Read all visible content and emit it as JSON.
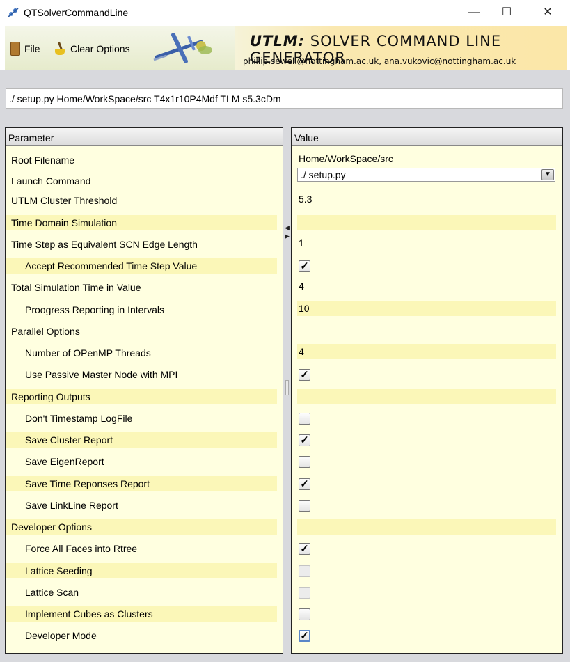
{
  "window": {
    "title": "QTSolverCommandLine",
    "minimize_glyph": "—",
    "maximize_glyph": "☐",
    "close_glyph": "✕"
  },
  "toolbar": {
    "file_label": "File",
    "clear_label": "Clear Options"
  },
  "banner": {
    "title_prefix": "UTLM:",
    "title_rest": " SOLVER COMMAND LINE GENERATOR",
    "emails": "phillip.sewell@nottingham.ac.uk, ana.vukovic@nottingham.ac.uk"
  },
  "command_line": "./ setup.py Home/WorkSpace/src T4x1r10P4Mdf TLM s5.3cDm",
  "table": {
    "param_header": "Parameter",
    "value_header": "Value",
    "rows": [
      {
        "param": "Root Filename",
        "indent": false,
        "hl": false,
        "type": "text",
        "value": "Home/WorkSpace/src"
      },
      {
        "param": "Launch Command",
        "indent": false,
        "hl": false,
        "type": "select",
        "value": "./ setup.py"
      },
      {
        "param": "UTLM Cluster Threshold",
        "indent": false,
        "hl": false,
        "type": "text",
        "value": "5.3"
      },
      {
        "param": "Time Domain Simulation",
        "indent": false,
        "hl": true,
        "type": "none",
        "value": ""
      },
      {
        "param": "Time Step as Equivalent SCN Edge Length",
        "indent": false,
        "hl": false,
        "type": "text",
        "value": "1"
      },
      {
        "param": "Accept Recommended Time Step Value",
        "indent": true,
        "hl": true,
        "type": "checkbox",
        "checked": true,
        "disabled": false,
        "focused": false
      },
      {
        "param": "Total Simulation Time in Value",
        "indent": false,
        "hl": false,
        "type": "text",
        "value": "4"
      },
      {
        "param": "Proogress Reporting in Intervals",
        "indent": true,
        "hl": false,
        "type": "text",
        "value": "10",
        "value_hl": true
      },
      {
        "param": "Parallel Options",
        "indent": false,
        "hl": false,
        "type": "none",
        "value": ""
      },
      {
        "param": "Number of OPenMP Threads",
        "indent": true,
        "hl": false,
        "type": "text",
        "value": "4",
        "value_hl": true
      },
      {
        "param": "Use Passive Master Node with MPI",
        "indent": true,
        "hl": false,
        "type": "checkbox",
        "checked": true,
        "disabled": false,
        "focused": false
      },
      {
        "param": "Reporting Outputs",
        "indent": false,
        "hl": true,
        "type": "none",
        "value": ""
      },
      {
        "param": "Don't Timestamp LogFile",
        "indent": true,
        "hl": false,
        "type": "checkbox",
        "checked": false,
        "disabled": false,
        "focused": false
      },
      {
        "param": "Save Cluster Report",
        "indent": true,
        "hl": true,
        "type": "checkbox",
        "checked": true,
        "disabled": false,
        "focused": false
      },
      {
        "param": "Save EigenReport",
        "indent": true,
        "hl": false,
        "type": "checkbox",
        "checked": false,
        "disabled": false,
        "focused": false
      },
      {
        "param": "Save Time Reponses Report",
        "indent": true,
        "hl": true,
        "type": "checkbox",
        "checked": true,
        "disabled": false,
        "focused": false
      },
      {
        "param": "Save LinkLine Report",
        "indent": true,
        "hl": false,
        "type": "checkbox",
        "checked": false,
        "disabled": false,
        "focused": false
      },
      {
        "param": "Developer Options",
        "indent": false,
        "hl": true,
        "type": "none",
        "value": "",
        "value_hl": true
      },
      {
        "param": "Force All Faces into Rtree",
        "indent": true,
        "hl": false,
        "type": "checkbox",
        "checked": true,
        "disabled": false,
        "focused": false
      },
      {
        "param": "Lattice Seeding",
        "indent": true,
        "hl": true,
        "type": "checkbox",
        "checked": false,
        "disabled": true,
        "focused": false
      },
      {
        "param": "Lattice Scan",
        "indent": true,
        "hl": false,
        "type": "checkbox",
        "checked": false,
        "disabled": true,
        "focused": false
      },
      {
        "param": "Implement Cubes as Clusters",
        "indent": true,
        "hl": true,
        "type": "checkbox",
        "checked": false,
        "disabled": false,
        "focused": false
      },
      {
        "param": "Developer Mode",
        "indent": true,
        "hl": false,
        "type": "checkbox",
        "checked": true,
        "disabled": false,
        "focused": true
      }
    ]
  },
  "icons": {
    "app": "app-icon",
    "file": "file-icon",
    "clear": "broom-icon",
    "check_glyph": "✓",
    "dropdown_glyph": "▼",
    "split_left_glyph": "◀",
    "split_right_glyph": "▶"
  }
}
